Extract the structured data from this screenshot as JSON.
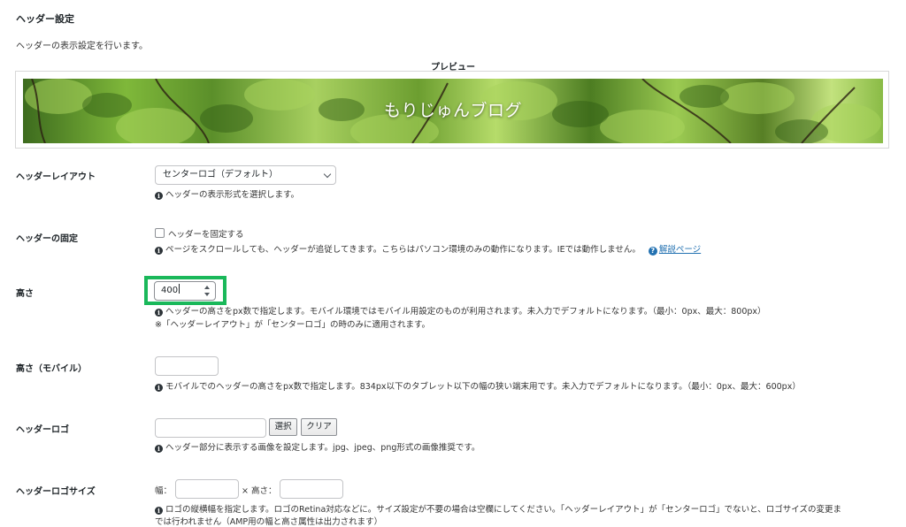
{
  "section": {
    "title": "ヘッダー設定",
    "description": "ヘッダーの表示設定を行います。"
  },
  "preview": {
    "label": "プレビュー",
    "site_title": "もりじゅんブログ"
  },
  "layout": {
    "label": "ヘッダーレイアウト",
    "selected": "センターロゴ（デフォルト）",
    "desc": "ヘッダーの表示形式を選択します。"
  },
  "fixed": {
    "label": "ヘッダーの固定",
    "checkbox_label": "ヘッダーを固定する",
    "checked": false,
    "desc": "ページをスクロールしても、ヘッダーが追従してきます。こちらはパソコン環境のみの動作になります。IEでは動作しません。",
    "help_link": "解説ページ"
  },
  "height": {
    "label": "高さ",
    "value": "400",
    "desc": "ヘッダーの高さをpx数で指定します。モバイル環境ではモバイル用設定のものが利用されます。未入力でデフォルトになります。（最小：0px、最大：800px）",
    "note": "※「ヘッダーレイアウト」が「センターロゴ」の時のみに適用されます。"
  },
  "height_mobile": {
    "label": "高さ（モバイル）",
    "value": "",
    "desc": "モバイルでのヘッダーの高さをpx数で指定します。834px以下のタブレット以下の幅の狭い端末用です。未入力でデフォルトになります。（最小：0px、最大：600px）"
  },
  "logo": {
    "label": "ヘッダーロゴ",
    "value": "",
    "select_button": "選択",
    "clear_button": "クリア",
    "desc": "ヘッダー部分に表示する画像を設定します。jpg、jpeg、png形式の画像推奨です。"
  },
  "logo_size": {
    "label": "ヘッダーロゴサイズ",
    "width_label": "幅：",
    "height_label": "× 高さ：",
    "desc_line1": "ロゴの縦横幅を指定します。ロゴのRetina対応などに。サイズ設定が不要の場合は空欄にしてください。「ヘッダーレイアウト」が「センターロゴ」でないと、ロゴサイズの変更ま",
    "desc_line2": "では行われません（AMP用の幅と高さ属性は出力されます）"
  },
  "colors": {
    "highlight": "#1ab85a",
    "link": "#2271b1"
  }
}
